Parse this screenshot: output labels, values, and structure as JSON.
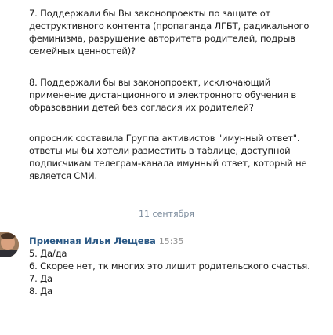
{
  "messages": {
    "q7": "7. Поддержали бы Вы законопроекты по защите от\nдеструктивного контента (пропаганда ЛГБТ, радикального\nфеминизма, разрушение авторитета родителей, подрыв\nсемейных ценностей)?",
    "q8": "8. Поддержали бы вы законопроект, исключающий\nприменение дистанционного и электронного обучения в\nобразовании детей без согласия их родителей?",
    "note": "опросник составила Группа активистов \"имунный ответ\".\nответы мы бы хотели разместить в таблице, доступной\nподписчикам телеграм-канала имунный ответ, который не\nявляется СМИ."
  },
  "date_separator": "11 сентября",
  "reply": {
    "author": "Приемная Ильи Лещева",
    "time": "15:35",
    "lines": [
      "5. Да/да",
      "6. Скорее нет, тк многих это лишит родительского счастья.",
      "7. Да",
      "8. Да"
    ]
  },
  "colors": {
    "author_link": "#2a5885",
    "date_text": "#7a8a9b",
    "time_text": "#939393",
    "body_text": "#222222"
  }
}
